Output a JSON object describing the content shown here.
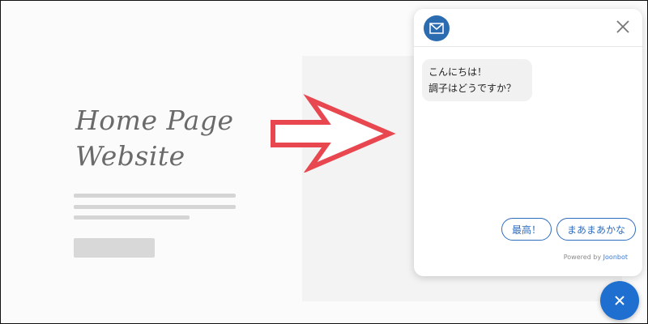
{
  "mockup": {
    "title_line1": "Home Page",
    "title_line2": "Website"
  },
  "chat": {
    "header": {
      "avatar_icon": "envelope-icon",
      "close_icon": "close-icon"
    },
    "message": {
      "line1": "こんにちは！",
      "line2": "調子はどうですか？"
    },
    "quick_replies": [
      "最高！",
      "まあまあかな"
    ],
    "powered_by": {
      "prefix": "Powered by",
      "brand": "Joonbot"
    }
  },
  "launcher": {
    "icon": "close-icon"
  },
  "colors": {
    "accent": "#1f6fd0",
    "arrow": "#e8474f",
    "brand_link": "#3b7ad6"
  }
}
